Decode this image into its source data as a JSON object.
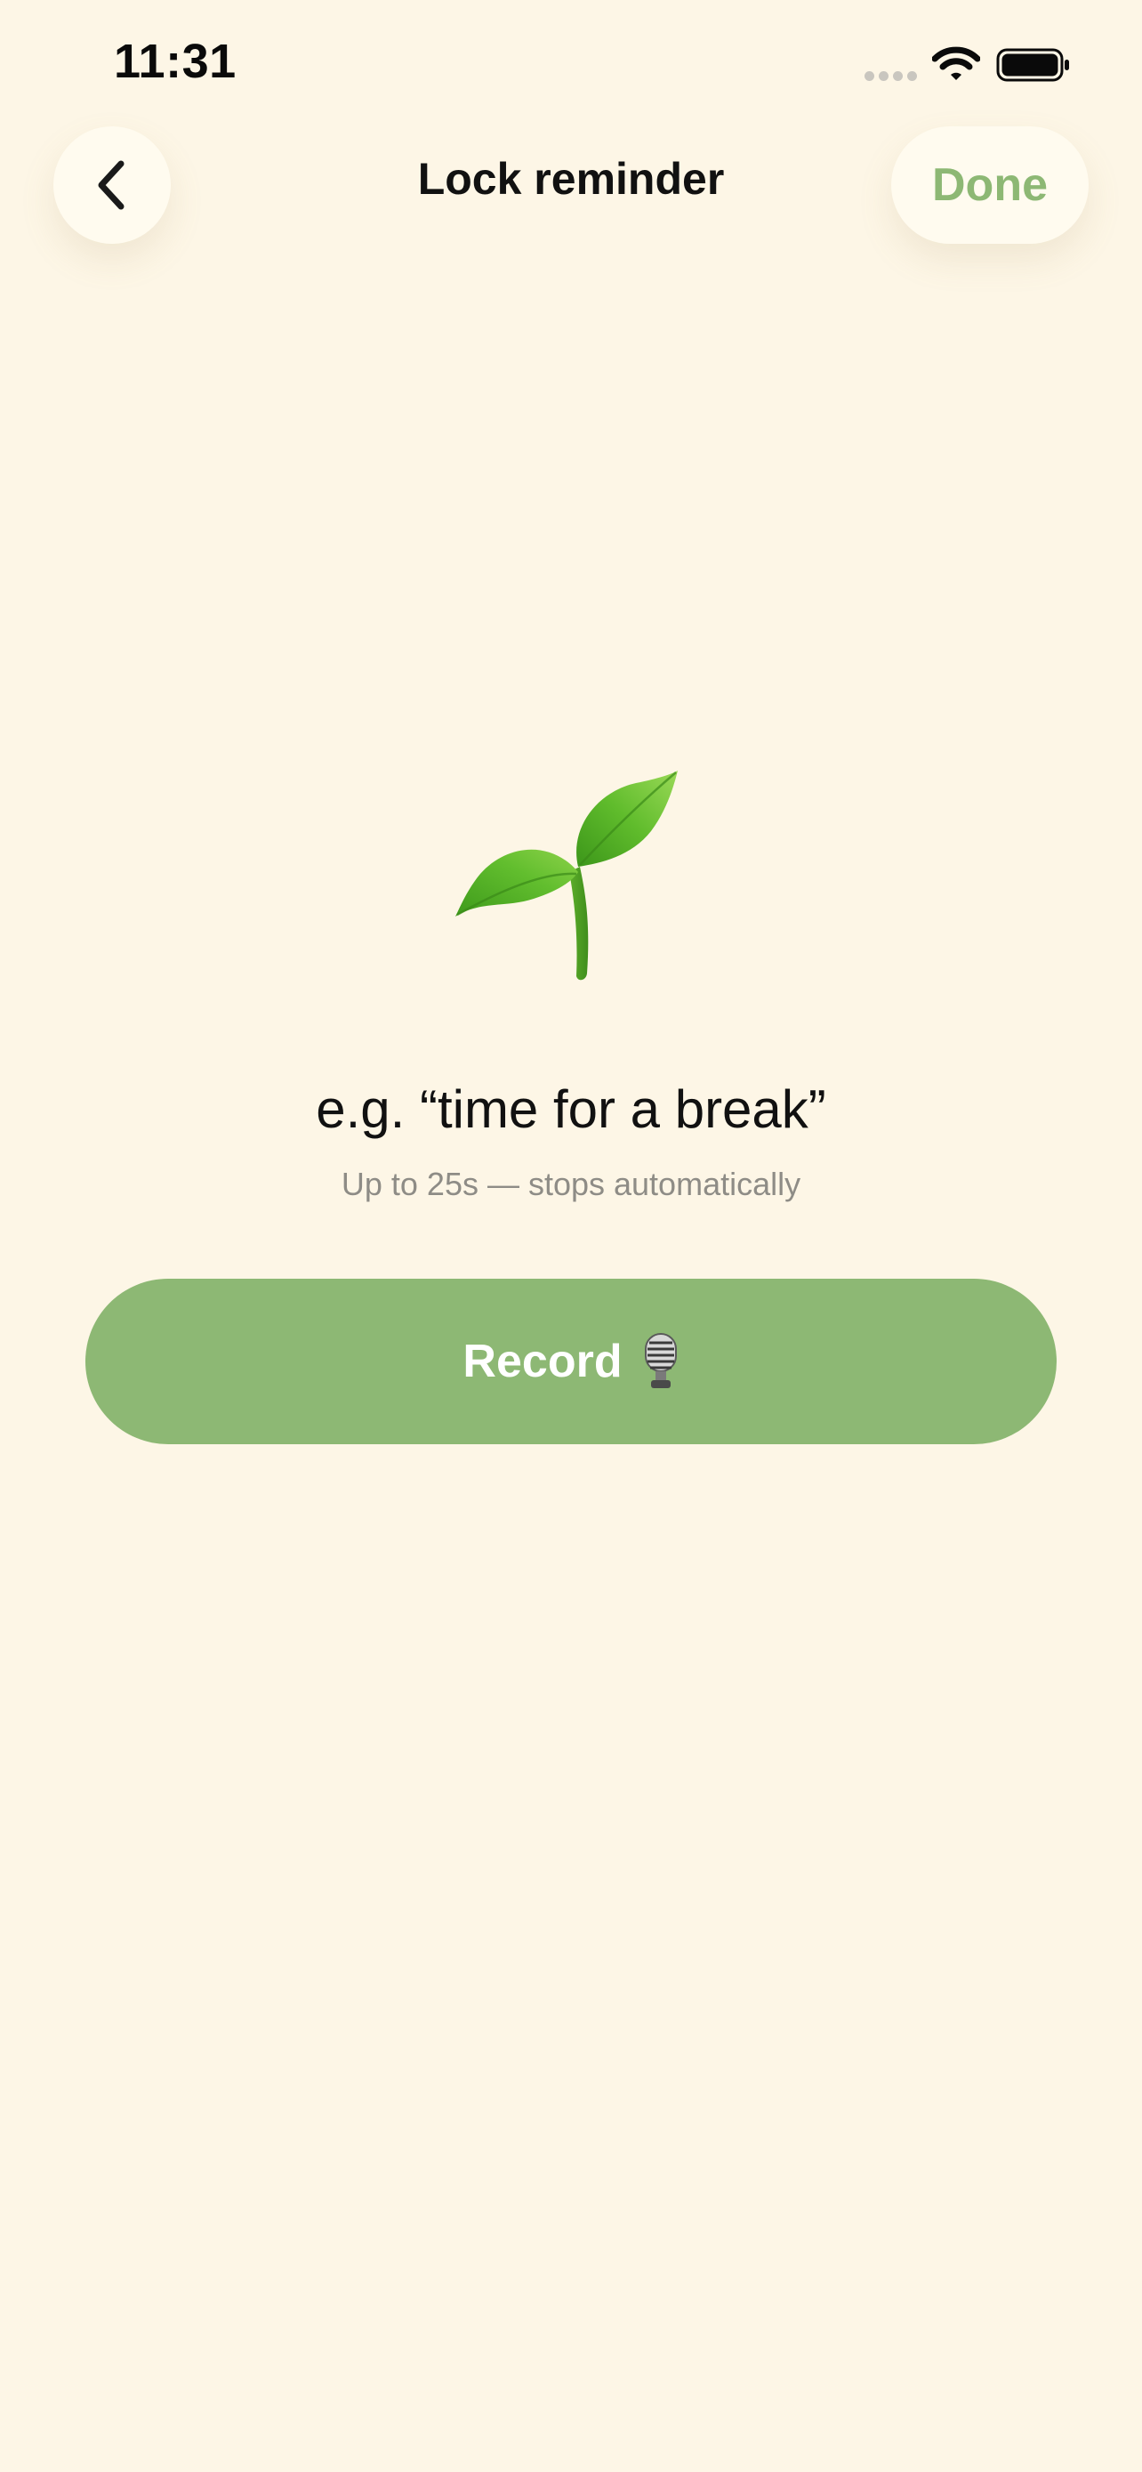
{
  "status_bar": {
    "time": "11:31",
    "icons": [
      "signal-dots-icon",
      "wifi-icon",
      "battery-icon"
    ]
  },
  "header": {
    "back_icon": "chevron-left-icon",
    "title": "Lock reminder",
    "done_label": "Done"
  },
  "main": {
    "illustration": "seedling-icon",
    "prompt": "e.g. “time for a break”",
    "hint": "Up to 25s — stops automatically",
    "record_button": {
      "label": "Record",
      "icon": "microphone-icon"
    }
  },
  "colors": {
    "background": "#FDF6E6",
    "accent": "#8DB874",
    "button_surface": "#FFFBEF",
    "hint_text": "#8E8C86"
  }
}
